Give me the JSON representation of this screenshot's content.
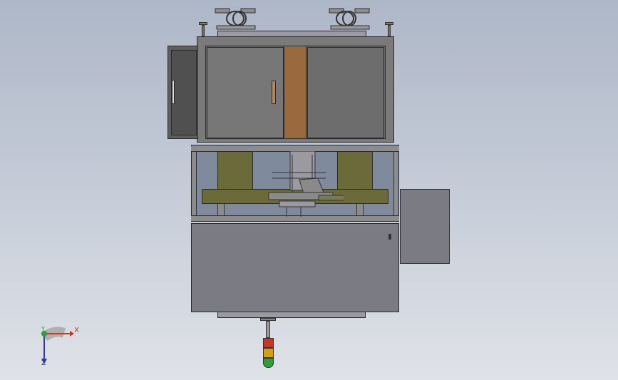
{
  "viewport": {
    "background_top": "#aeb7c8",
    "background_bottom": "#dfe2e8"
  },
  "model": {
    "cabinet_color": "#6f6f6f",
    "base_color": "#7b7b84",
    "accent_copper": "#9a6a3e",
    "tank_olive": "#6b6b3a",
    "stack_light_colors": [
      "#c0392b",
      "#d4a017",
      "#2e9e3a"
    ]
  },
  "triad": {
    "x_label": "X",
    "y_label": "Y",
    "z_label": "Z",
    "x_color": "#c0392b",
    "y_color": "#2e9e3a",
    "z_color": "#2c3e9e"
  }
}
